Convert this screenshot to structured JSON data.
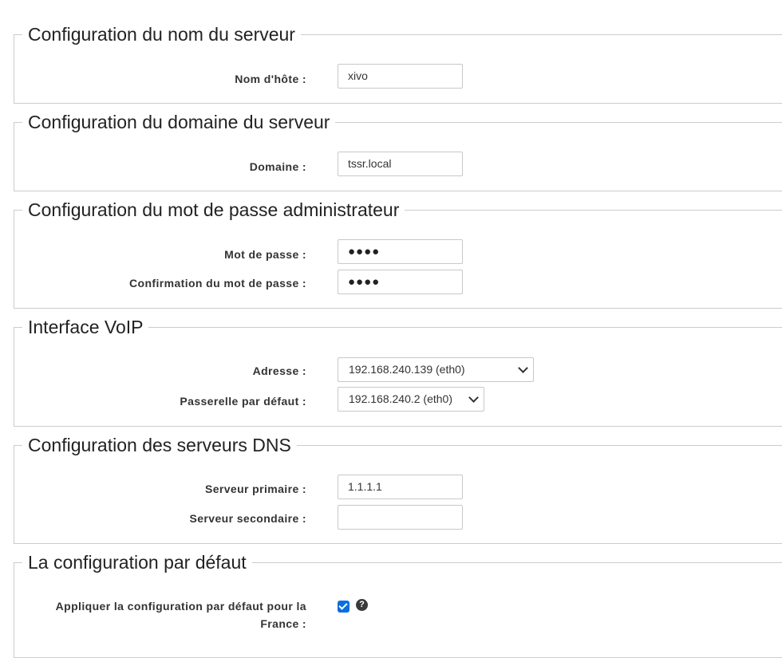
{
  "sections": [
    {
      "title": "Configuration du nom du serveur",
      "fields": [
        {
          "label": "Nom d'hôte :",
          "value": "xivo"
        }
      ]
    },
    {
      "title": "Configuration du domaine du serveur",
      "fields": [
        {
          "label": "Domaine :",
          "value": "tssr.local"
        }
      ]
    },
    {
      "title": "Configuration du mot de passe administrateur",
      "fields": [
        {
          "label": "Mot de passe :",
          "value": "●●●●"
        },
        {
          "label": "Confirmation du mot de passe :",
          "value": "●●●●"
        }
      ]
    },
    {
      "title": "Interface VoIP",
      "fields": [
        {
          "label": "Adresse :",
          "value": "192.168.240.139 (eth0)"
        },
        {
          "label": "Passerelle par défaut :",
          "value": "192.168.240.2 (eth0)"
        }
      ]
    },
    {
      "title": "Configuration des serveurs DNS",
      "fields": [
        {
          "label": "Serveur primaire :",
          "value": "1.1.1.1"
        },
        {
          "label": "Serveur secondaire :",
          "value": ""
        }
      ]
    },
    {
      "title": "La configuration par défaut",
      "fields": [
        {
          "label_line1": "Appliquer la configuration par défaut pour la",
          "label_line2": "France :",
          "checked": true,
          "help_icon": "question-circle-icon"
        }
      ]
    }
  ],
  "colors": {
    "checkbox": "#0a6ee0",
    "border": "#cccccc"
  }
}
